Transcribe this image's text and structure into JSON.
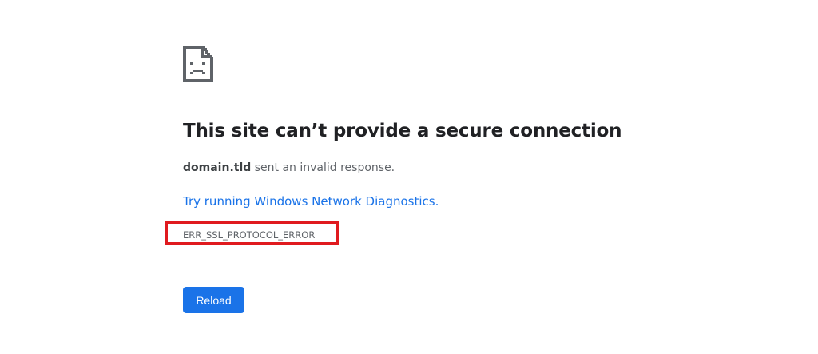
{
  "error_page": {
    "icon": "sad-page-icon",
    "heading": "This site can’t provide a secure connection",
    "summary": {
      "domain": "domain.tld",
      "text": " sent an invalid response."
    },
    "diagnostics_link": "Try running Windows Network Diagnostics.",
    "error_code": "ERR_SSL_PROTOCOL_ERROR",
    "reload_label": "Reload"
  },
  "colors": {
    "heading": "#202124",
    "body_text": "#5f6368",
    "link": "#1a73e8",
    "button_bg": "#1a73e8",
    "highlight_border": "#e01a1f",
    "icon": "#5f6368"
  }
}
